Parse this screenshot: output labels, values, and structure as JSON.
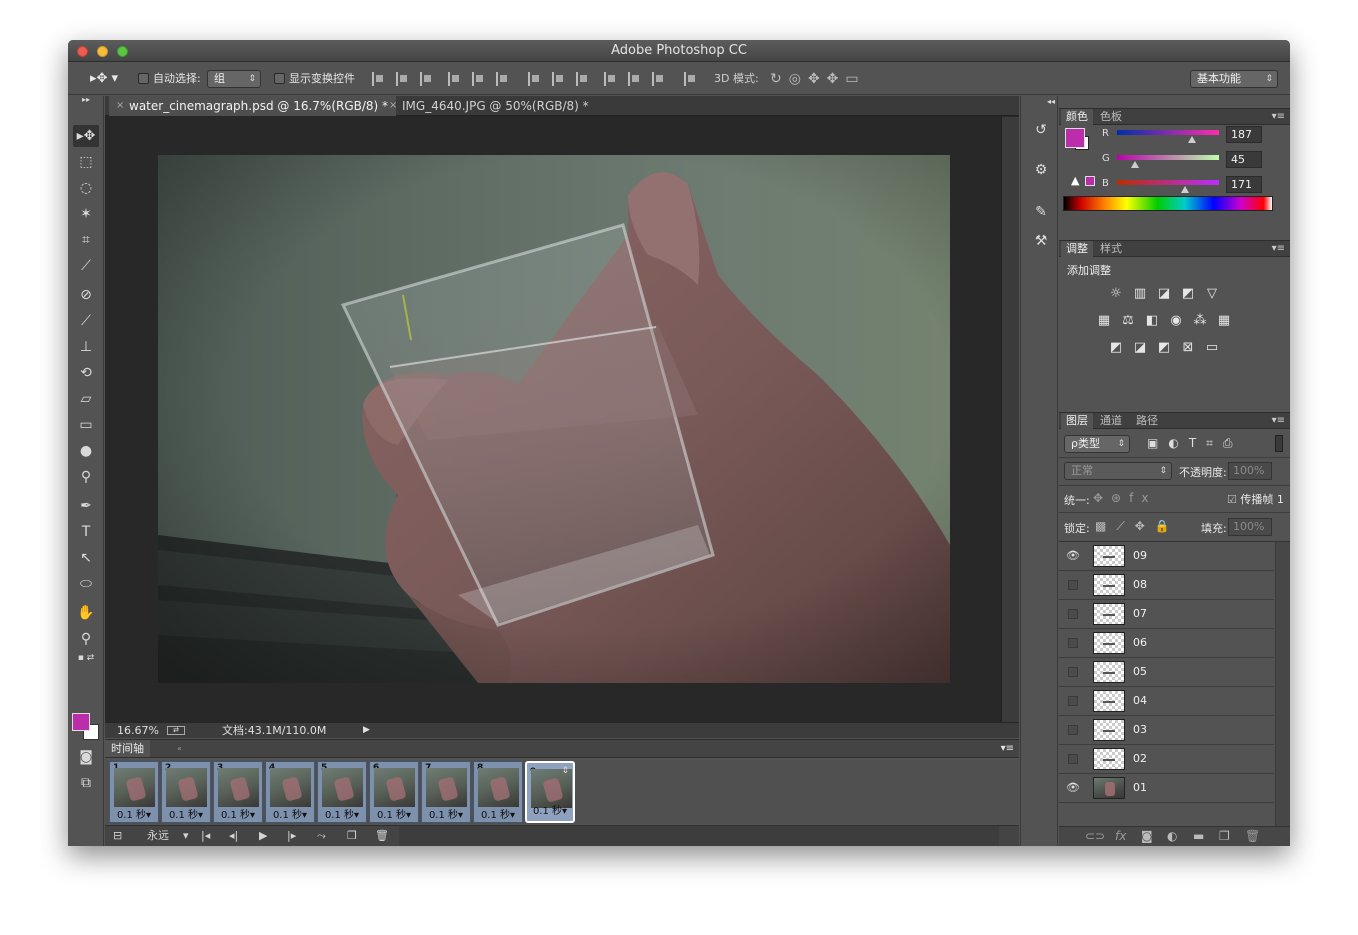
{
  "window": {
    "title": "Adobe Photoshop CC"
  },
  "options_bar": {
    "auto_select_label": "自动选择:",
    "auto_select_value": "组",
    "show_transform_label": "显示变换控件",
    "mode_3d_label": "3D 模式:",
    "workspace": "基本功能"
  },
  "tabs": [
    {
      "label": "water_cinemagraph.psd @ 16.7%(RGB/8) *",
      "active": true
    },
    {
      "label": "IMG_4640.JPG @ 50%(RGB/8) *",
      "active": false
    }
  ],
  "status": {
    "zoom": "16.67%",
    "doc_size": "文档:43.1M/110.0M"
  },
  "timeline": {
    "title": "时间轴",
    "frames": [
      {
        "num": "1",
        "delay": "0.1 秒▾"
      },
      {
        "num": "2",
        "delay": "0.1 秒▾"
      },
      {
        "num": "3",
        "delay": "0.1 秒▾"
      },
      {
        "num": "4",
        "delay": "0.1 秒▾"
      },
      {
        "num": "5",
        "delay": "0.1 秒▾"
      },
      {
        "num": "6",
        "delay": "0.1 秒▾"
      },
      {
        "num": "7",
        "delay": "0.1 秒▾"
      },
      {
        "num": "8",
        "delay": "0.1 秒▾"
      },
      {
        "num": "9",
        "delay": "0.1 秒▾"
      }
    ],
    "loop": "永远",
    "selected_frame": "9"
  },
  "color_panel": {
    "tabs": [
      "颜色",
      "色板"
    ],
    "foreground": "#bb2dab",
    "r_label": "R",
    "r": "187",
    "g_label": "G",
    "g": "45",
    "b_label": "B",
    "b": "171"
  },
  "adjustments_panel": {
    "tabs": [
      "调整",
      "样式"
    ],
    "heading": "添加调整"
  },
  "layers_panel": {
    "tabs": [
      "图层",
      "通道",
      "路径"
    ],
    "filter": "ρ类型",
    "blend_mode": "正常",
    "opacity_label": "不透明度:",
    "opacity": "100%",
    "unify_label": "统一:",
    "propagate_label": "传播帧 1",
    "lock_label": "锁定:",
    "fill_label": "填充:",
    "fill": "100%",
    "layers": [
      {
        "name": "09",
        "visible": true
      },
      {
        "name": "08",
        "visible": false
      },
      {
        "name": "07",
        "visible": false
      },
      {
        "name": "06",
        "visible": false
      },
      {
        "name": "05",
        "visible": false
      },
      {
        "name": "04",
        "visible": false
      },
      {
        "name": "03",
        "visible": false
      },
      {
        "name": "02",
        "visible": false
      },
      {
        "name": "01",
        "visible": true
      }
    ]
  },
  "glyphs": {
    "eye": "👁",
    "type_t": "T",
    "fx": "fx",
    "play": "▶",
    "menu": "≡"
  }
}
